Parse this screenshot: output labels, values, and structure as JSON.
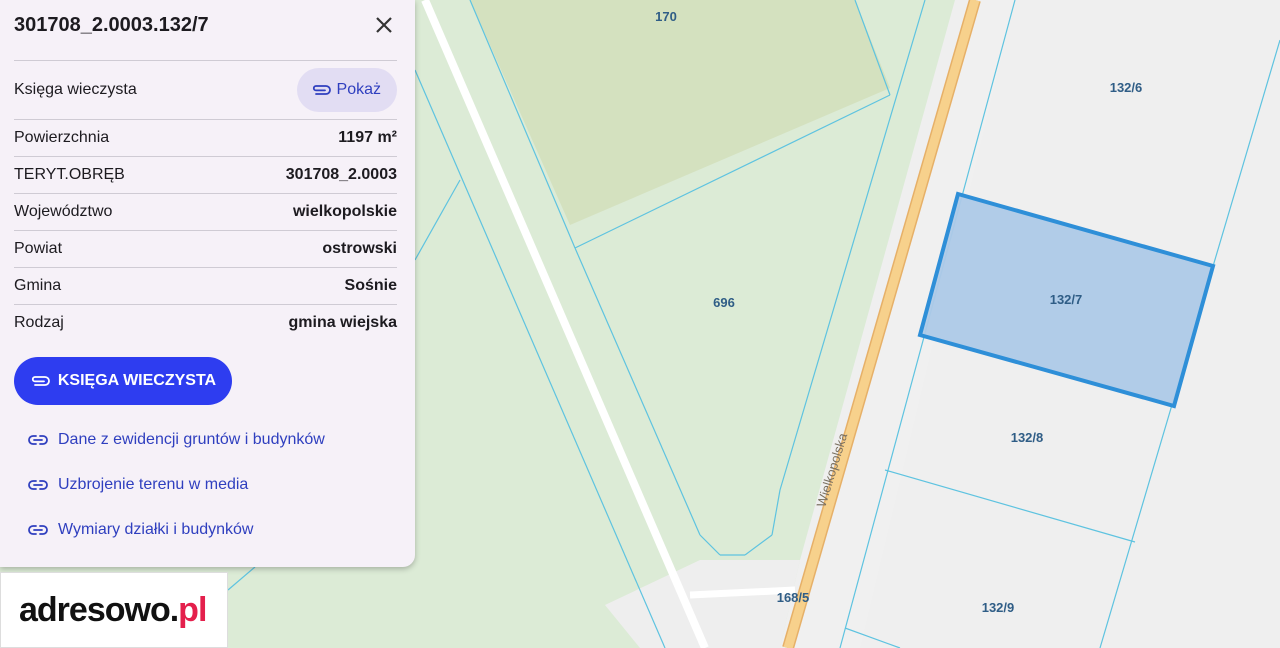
{
  "panel": {
    "title": "301708_2.0003.132/7",
    "kw_row": {
      "label": "Księga wieczysta",
      "button": "Pokaż"
    },
    "rows": [
      {
        "label": "Powierzchnia",
        "value": "1197 m²"
      },
      {
        "label": "TERYT.OBRĘB",
        "value": "301708_2.0003"
      },
      {
        "label": "Województwo",
        "value": "wielkopolskie"
      },
      {
        "label": "Powiat",
        "value": "ostrowski"
      },
      {
        "label": "Gmina",
        "value": "Sośnie"
      },
      {
        "label": "Rodzaj",
        "value": "gmina wiejska"
      }
    ],
    "kw_button": "KSIĘGA WIECZYSTA",
    "links": [
      "Dane z ewidencji gruntów i budynków",
      "Uzbrojenie terenu w media",
      "Wymiary działki i budynków"
    ]
  },
  "logo": {
    "main": "adresowo.",
    "accent": "pl"
  },
  "map": {
    "parcels": [
      "170",
      "132/6",
      "696",
      "132/7",
      "132/8",
      "168/5",
      "132/9"
    ],
    "street": "Wielkopolska",
    "colors": {
      "selected_fill": "#adc9e7",
      "selected_stroke": "#2e8fd8",
      "parcel_line": "#5ec3e0",
      "road": "#f7d18c"
    }
  }
}
